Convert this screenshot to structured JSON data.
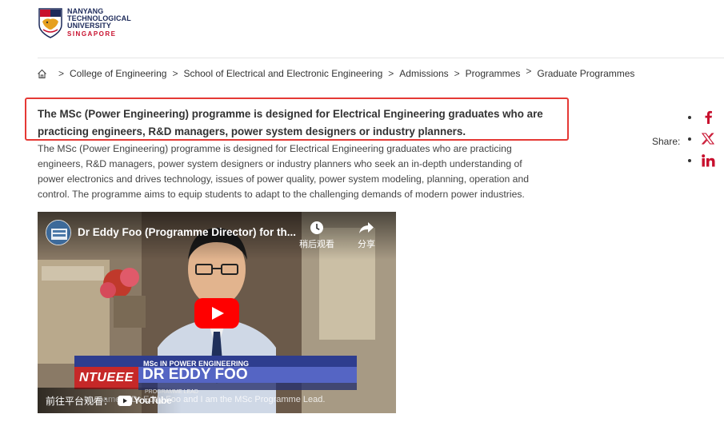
{
  "logo": {
    "line1": "NANYANG",
    "line2": "TECHNOLOGICAL",
    "line3": "UNIVERSITY",
    "line4": "SINGAPORE"
  },
  "breadcrumb": {
    "items": [
      "College of Engineering",
      "School of Electrical and Electronic Engineering",
      "Admissions",
      "Programmes",
      "Graduate Programmes"
    ],
    "separator": ">"
  },
  "main": {
    "lead": "The MSc (Power Engineering) programme is designed for Electrical Engineering graduates who are practicing engineers, R&D managers, power system designers or industry planners.",
    "body": "The MSc (Power Engineering) programme is designed for Electrical Engineering graduates who are practicing engineers, R&D managers, power system designers or industry planners who seek an in-depth understanding of power electronics and drives technology, issues of power quality, power system modeling, planning, operation and control. The programme aims to equip students to adapt to the challenging demands of modern power industries."
  },
  "share": {
    "label": "Share:",
    "icons": [
      "facebook-icon",
      "x-icon",
      "linkedin-icon"
    ],
    "color": "#c8102e"
  },
  "video": {
    "title": "Dr Eddy Foo (Programme Director) for th...",
    "watch_later": "稍后观看",
    "share": "分享",
    "lower_third_top": "MSc IN POWER ENGINEERING",
    "lower_third_brand": "NTUEEE",
    "lower_third_name": "DR EDDY FOO",
    "lower_third_role": "PROGRAMME LEAD",
    "subtitle": "My name is Dr Eddy Foo and I am the MSc Programme Lead.",
    "watch_on": "前往平台观看：",
    "youtube": "YouTube",
    "play_color": "#ff0000"
  }
}
